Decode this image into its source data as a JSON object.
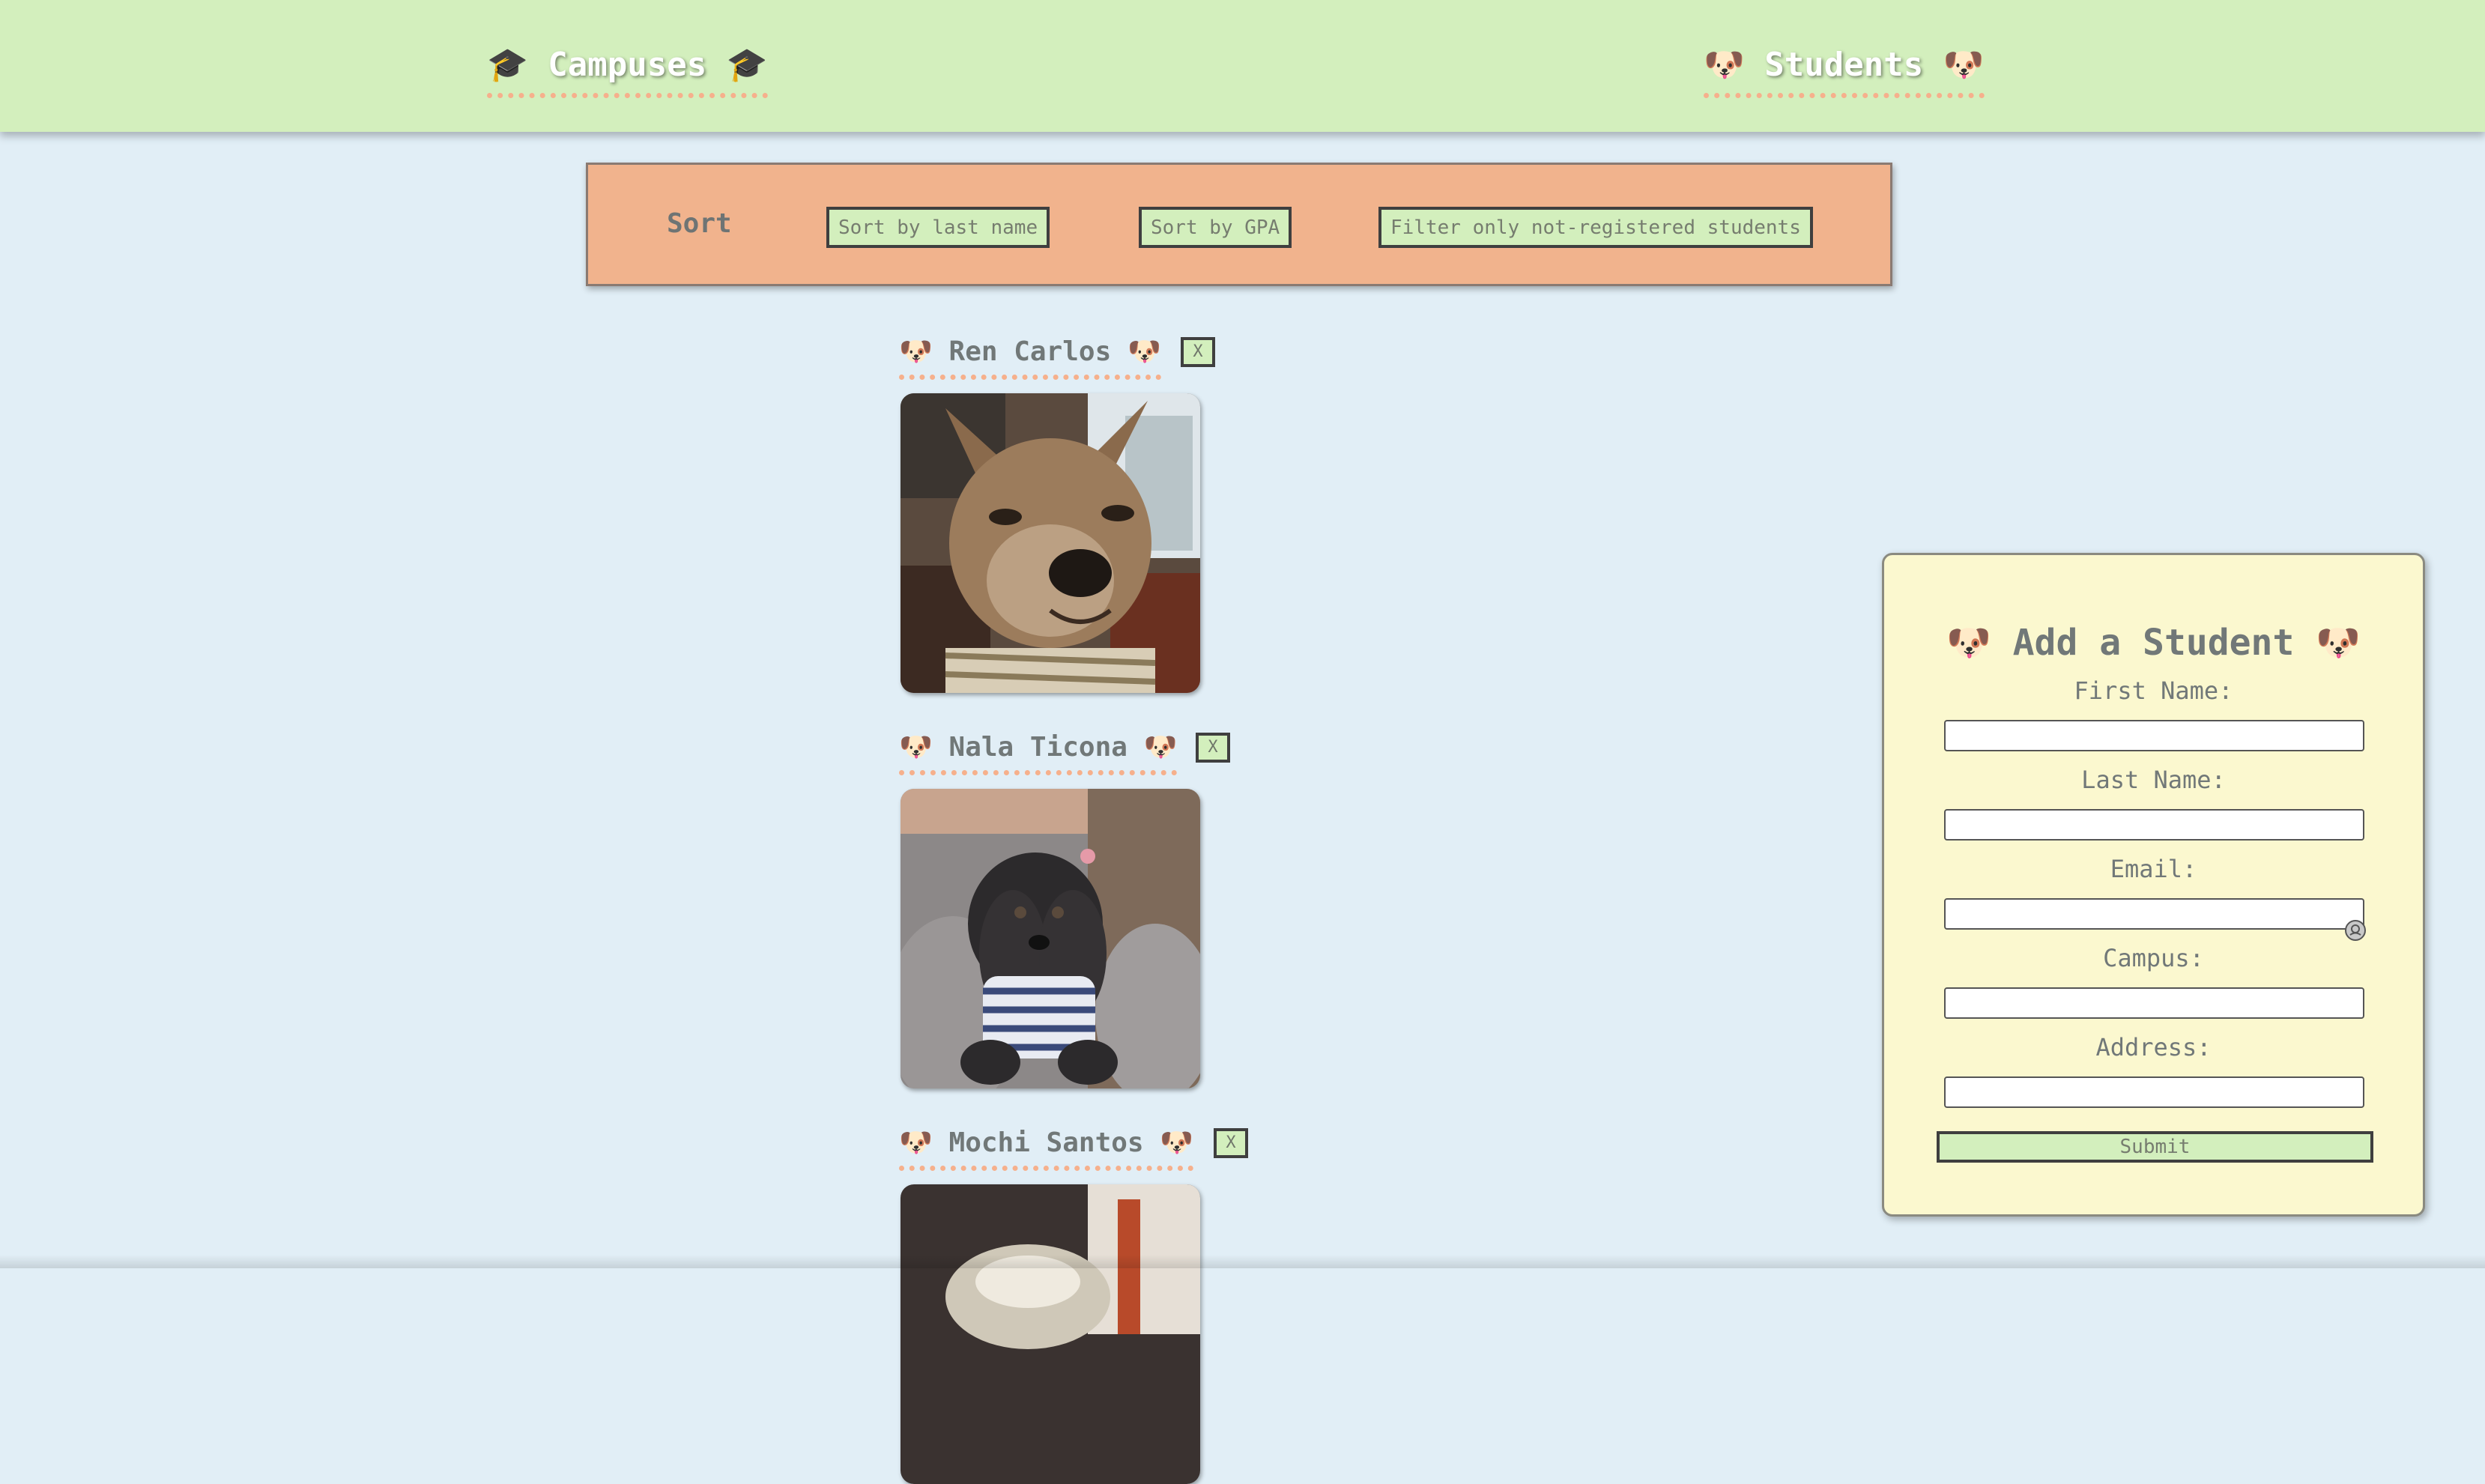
{
  "nav": {
    "campuses": {
      "label": "Campuses",
      "icon": "graduation-cap-icon",
      "glyph": "🎓"
    },
    "students": {
      "label": "Students",
      "icon": "dog-face-icon",
      "glyph": "🐶"
    }
  },
  "sort": {
    "label": "Sort",
    "buttons": [
      "Sort by last name",
      "Sort by GPA",
      "Filter only not-registered students"
    ]
  },
  "students": [
    {
      "name": "Ren Carlos",
      "delete_label": "X"
    },
    {
      "name": "Nala Ticona",
      "delete_label": "X"
    },
    {
      "name": "Mochi Santos",
      "delete_label": "X"
    }
  ],
  "form": {
    "title": "Add a Student",
    "fields": [
      {
        "label": "First Name:",
        "value": ""
      },
      {
        "label": "Last Name:",
        "value": ""
      },
      {
        "label": "Email:",
        "value": ""
      },
      {
        "label": "Campus:",
        "value": ""
      },
      {
        "label": "Address:",
        "value": ""
      }
    ],
    "submit_label": "Submit"
  },
  "colors": {
    "background": "#e1eef6",
    "nav": "#d3efbd",
    "sort_bar": "#f1b38d",
    "form_card": "#fbf8cf",
    "dotted_underline": "#f6b08c"
  }
}
